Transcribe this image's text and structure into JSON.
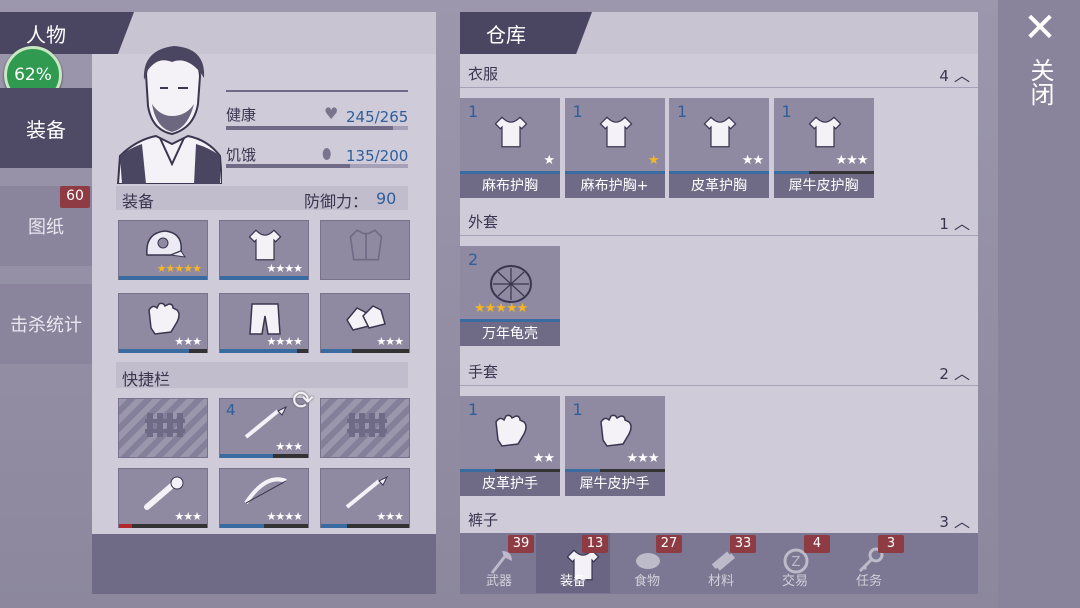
{
  "character": {
    "title": "人物",
    "completion": "62%",
    "health_label": "健康",
    "health_value": "245/265",
    "health_fill": 0.92,
    "hunger_label": "饥饿",
    "hunger_value": "135/200",
    "hunger_fill": 0.68,
    "equip_label": "装备",
    "defense_label": "防御力：",
    "defense_value": "90",
    "quickbar_label": "快捷栏"
  },
  "side_tabs": [
    {
      "label": "装备",
      "active": true
    },
    {
      "label": "图纸",
      "badge": "60"
    },
    {
      "label": "击杀统计"
    }
  ],
  "equipment_slots": [
    {
      "icon": "helmet-icon",
      "stars": "★★★★★",
      "star_color": "gold",
      "durability": 1.0
    },
    {
      "icon": "shirt-icon",
      "stars": "★★★★",
      "star_color": "white",
      "durability": 1.0
    },
    {
      "icon": "jacket-empty-icon",
      "stars": "",
      "star_color": "white",
      "durability": null
    },
    {
      "icon": "glove-icon",
      "stars": "★★★",
      "star_color": "white",
      "durability": 0.8
    },
    {
      "icon": "pants-icon",
      "stars": "★★★★",
      "star_color": "white",
      "durability": 0.88
    },
    {
      "icon": "boots-icon",
      "stars": "★★★",
      "star_color": "white",
      "durability": 0.35
    }
  ],
  "quick_slots": [
    {
      "icon": "locked-fence-icon",
      "locked": true
    },
    {
      "icon": "spear-icon",
      "count": "4",
      "stars": "★★★",
      "durability": 0.6
    },
    {
      "icon": "locked-fence-icon",
      "locked": true
    },
    {
      "icon": "wrench-icon",
      "stars": "★★★",
      "durability": 0.15,
      "bar_color": "#b3262a"
    },
    {
      "icon": "bow-icon",
      "stars": "★★★★",
      "durability": 0.5
    },
    {
      "icon": "spear-icon",
      "stars": "★★★",
      "durability": 0.3
    }
  ],
  "storage": {
    "title": "仓库",
    "categories": [
      {
        "name": "衣服",
        "count": "4",
        "items": [
          {
            "count": "1",
            "name": "麻布护胸",
            "stars": "★",
            "star_color": "white",
            "durability": 1.0
          },
          {
            "count": "1",
            "name": "麻布护胸+",
            "stars": "★",
            "star_color": "gold",
            "durability": 1.0
          },
          {
            "count": "1",
            "name": "皮革护胸",
            "stars": "★★",
            "star_color": "white",
            "durability": 1.0
          },
          {
            "count": "1",
            "name": "犀牛皮护胸",
            "stars": "★★★",
            "star_color": "white",
            "durability": 0.35
          }
        ]
      },
      {
        "name": "外套",
        "count": "1",
        "items": [
          {
            "count": "2",
            "name": "万年龟壳",
            "stars": "★★★★★",
            "star_color": "gold",
            "durability": 1.0
          }
        ]
      },
      {
        "name": "手套",
        "count": "2",
        "items": [
          {
            "count": "1",
            "name": "皮革护手",
            "stars": "★★",
            "star_color": "white",
            "durability": 0.35
          },
          {
            "count": "1",
            "name": "犀牛皮护手",
            "stars": "★★★",
            "star_color": "white",
            "durability": 0.35
          }
        ]
      },
      {
        "name": "裤子",
        "count": "3",
        "items": []
      }
    ]
  },
  "bottom_tabs": [
    {
      "label": "武器",
      "badge": "39",
      "icon": "axe-icon"
    },
    {
      "label": "装备",
      "badge": "13",
      "icon": "shirt-icon",
      "active": true
    },
    {
      "label": "食物",
      "badge": "27",
      "icon": "meat-icon"
    },
    {
      "label": "材料",
      "badge": "33",
      "icon": "wood-icon"
    },
    {
      "label": "交易",
      "badge": "4",
      "icon": "coin-icon"
    },
    {
      "label": "任务",
      "badge": "3",
      "icon": "key-icon"
    }
  ],
  "close": {
    "label": "关闭"
  }
}
